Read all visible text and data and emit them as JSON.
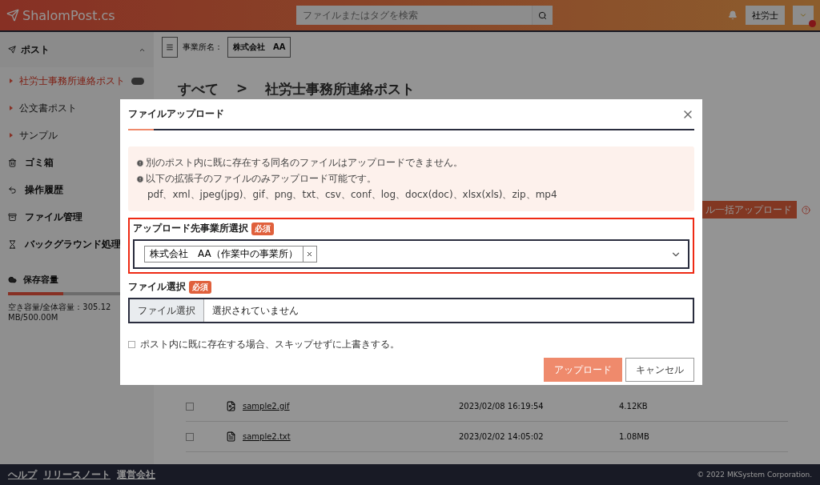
{
  "header": {
    "logo": "ShalomPost.cs",
    "search": {
      "placeholder": "ファイルまたはタグを検索"
    },
    "user": "社労士",
    "notification_dot": true
  },
  "sidebar": {
    "section": {
      "label": "ポスト",
      "expanded": true,
      "items": [
        {
          "label": "社労士事務所連絡ポスト",
          "selected": true
        },
        {
          "label": "公文書ポスト",
          "selected": false
        },
        {
          "label": "サンプル",
          "selected": false
        }
      ]
    },
    "menu": [
      {
        "label": "ゴミ箱",
        "kind": "trash"
      },
      {
        "label": "操作履歴",
        "kind": "history"
      },
      {
        "label": "ファイル管理",
        "kind": "files"
      },
      {
        "label": "バックグラウンド処理",
        "kind": "hourglass"
      }
    ],
    "storage": {
      "label": "保存容量",
      "level": 0.4,
      "detail": "空き容量/全体容量：305.12MB/500.00M"
    }
  },
  "toolbar": {
    "office_label": "事業所名：",
    "office": "株式会社　AA"
  },
  "breadcrumb": [
    "すべて",
    ">",
    "社労士事務所連絡ポスト"
  ],
  "bulk_button": "ル一括アップロード",
  "table": {
    "rows": [
      {
        "name": "sample2.gif",
        "date": "2023/02/08 16:19:54",
        "size": "4.12KB",
        "checked": false
      },
      {
        "name": "sample2.txt",
        "date": "2023/02/02 14:05:02",
        "size": "1.08MB",
        "checked": false
      }
    ]
  },
  "footer": {
    "links": [
      "ヘルプ",
      "リリースノート",
      "運営会社"
    ],
    "copyright": "© 2022 MKSystem Corporation."
  },
  "modal": {
    "title": "ファイルアップロード",
    "notes": [
      "別のポスト内に既に存在する同名のファイルはアップロードできません。",
      "以下の拡張子のファイルのみアップロード可能です。"
    ],
    "extensions": "pdf、xml、jpeg(jpg)、gif、png、txt、csv、conf、log、docx(doc)、xlsx(xls)、zip、mp4",
    "office_field": {
      "label": "アップロード先事業所選択",
      "badge": "必須",
      "highlighted": true,
      "chips": [
        "株式会社　AA（作業中の事業所）"
      ]
    },
    "file_field": {
      "label": "ファイル選択",
      "badge": "必須",
      "button": "ファイル選択",
      "value": "選択されていません"
    },
    "overwrite": {
      "label": "ポスト内に既に存在する場合、スキップせずに上書きする。",
      "checked": false
    },
    "buttons": [
      {
        "label": "アップロード",
        "kind": "primary"
      },
      {
        "label": "キャンセル",
        "kind": "secondary"
      }
    ]
  }
}
